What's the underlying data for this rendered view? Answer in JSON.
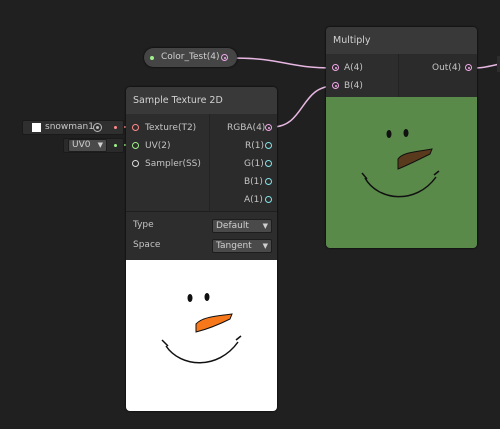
{
  "color_node": {
    "label": "Color_Test(4)"
  },
  "multiply_node": {
    "title": "Multiply",
    "inputs": [
      "A(4)",
      "B(4)"
    ],
    "output": "Out(4)"
  },
  "sample_node": {
    "title": "Sample Texture 2D",
    "inputs": [
      "Texture(T2)",
      "UV(2)",
      "Sampler(SS)"
    ],
    "outputs": [
      "RGBA(4)",
      "R(1)",
      "G(1)",
      "B(1)",
      "A(1)"
    ],
    "type_label": "Type",
    "type_value": "Default",
    "space_label": "Space",
    "space_value": "Tangent"
  },
  "texture_field": {
    "value": "snowman1"
  },
  "uv_field": {
    "value": "UV0"
  },
  "colors": {
    "background": "#202020",
    "node": "#2d2d2d",
    "header": "#393939",
    "vector4_port": "#f0a8e8",
    "texture_port": "#ff8a8a",
    "vector2_port": "#9ef08a",
    "float_port": "#84e4e7",
    "preview_green": "#5a8a4a"
  }
}
